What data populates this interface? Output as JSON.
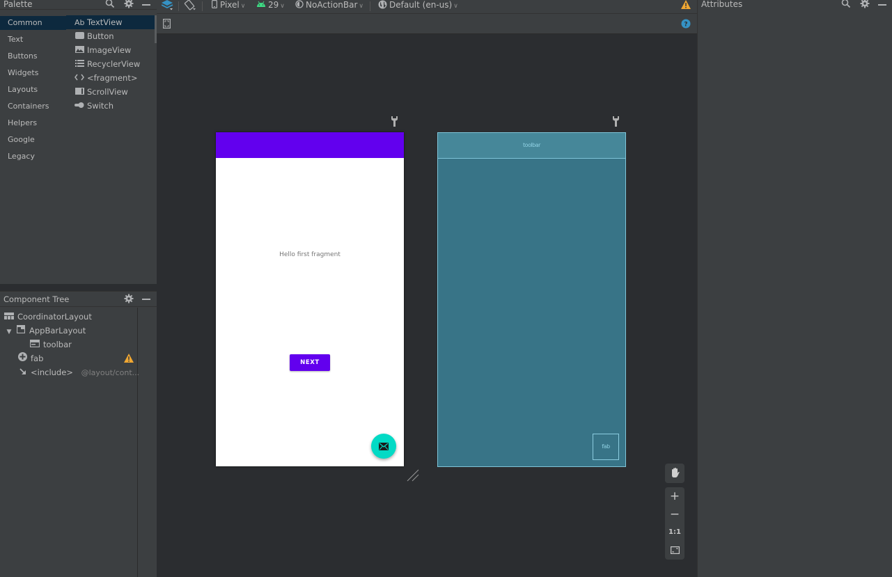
{
  "palette": {
    "title": "Palette",
    "categories": [
      {
        "label": "Common",
        "selected": true
      },
      {
        "label": "Text"
      },
      {
        "label": "Buttons"
      },
      {
        "label": "Widgets"
      },
      {
        "label": "Layouts"
      },
      {
        "label": "Containers"
      },
      {
        "label": "Helpers"
      },
      {
        "label": "Google"
      },
      {
        "label": "Legacy"
      }
    ],
    "items": [
      {
        "icon": "Ab",
        "label": "TextView",
        "selected": true
      },
      {
        "icon": "button-icon",
        "label": "Button"
      },
      {
        "icon": "image-icon",
        "label": "ImageView"
      },
      {
        "icon": "list-icon",
        "label": "RecyclerView"
      },
      {
        "icon": "code-icon",
        "label": "<fragment>"
      },
      {
        "icon": "scroll-icon",
        "label": "ScrollView"
      },
      {
        "icon": "switch-icon",
        "label": "Switch"
      }
    ]
  },
  "toolbar": {
    "device": "Pixel",
    "api": "29",
    "theme": "NoActionBar",
    "locale": "Default (en-us)"
  },
  "component_tree": {
    "title": "Component Tree",
    "items": [
      {
        "label": "CoordinatorLayout",
        "icon": "coordinator-icon"
      },
      {
        "label": "AppBarLayout",
        "icon": "appbar-icon",
        "expanded": true
      },
      {
        "label": "toolbar",
        "icon": "toolbar-icon"
      },
      {
        "label": "fab",
        "icon": "fab-icon",
        "warning": true
      },
      {
        "label": "<include>",
        "icon": "include-icon",
        "detail": "@layout/cont..."
      }
    ]
  },
  "attributes": {
    "title": "Attributes"
  },
  "design": {
    "hello_text": "Hello first fragment",
    "next_button": "NEXT",
    "colors": {
      "primary": "#6200ee",
      "secondary": "#03dac5"
    }
  },
  "blueprint": {
    "toolbar_label": "toolbar",
    "fab_label": "fab"
  },
  "zoom_controls": {
    "zoom_in": "+",
    "zoom_out": "−",
    "actual_size": "1:1"
  }
}
